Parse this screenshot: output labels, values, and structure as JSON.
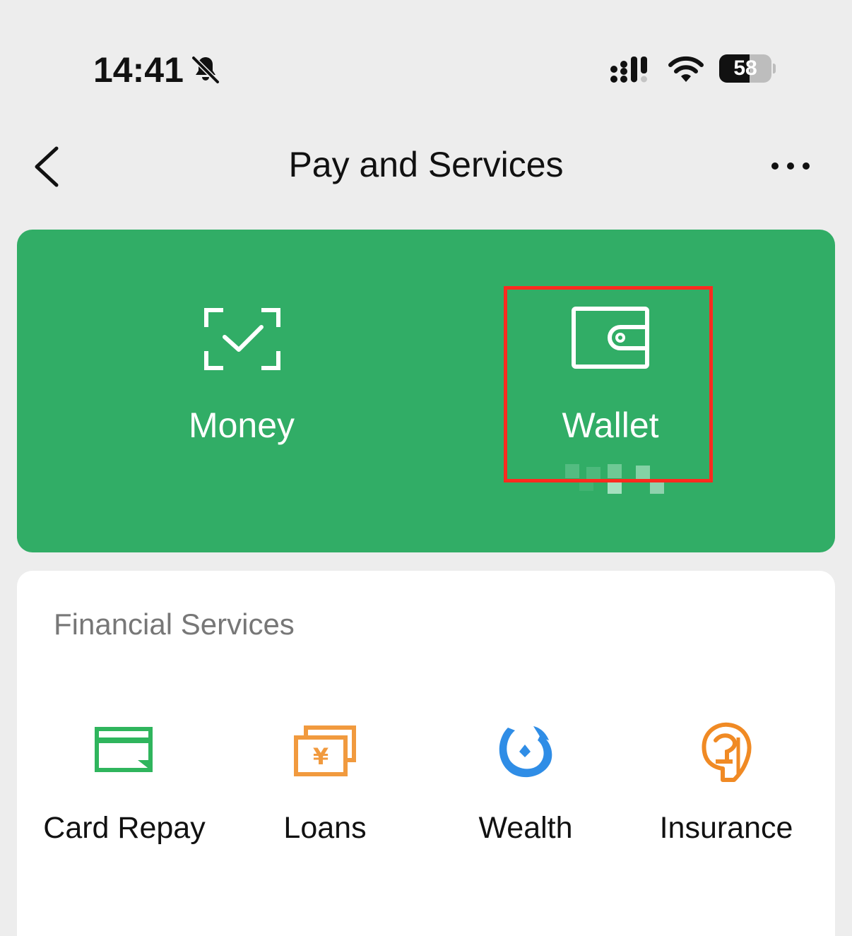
{
  "status_bar": {
    "time": "14:41",
    "battery_level": "58",
    "icons": [
      "bell-slash-icon",
      "cellular-signal-icon",
      "wifi-icon",
      "battery-icon"
    ]
  },
  "nav": {
    "title": "Pay and Services",
    "back_icon": "chevron-left-icon",
    "more_icon": "more-dots-icon"
  },
  "top_actions": [
    {
      "label": "Money",
      "icon": "scan-check-icon"
    },
    {
      "label": "Wallet",
      "icon": "wallet-icon",
      "highlighted": true
    }
  ],
  "financial_services": {
    "title": "Financial Services",
    "items": [
      {
        "label": "Card Repay",
        "icon": "card-repay-icon",
        "color": "#2fb55d"
      },
      {
        "label": "Loans",
        "icon": "loans-yen-icon",
        "color": "#f19a3e"
      },
      {
        "label": "Wealth",
        "icon": "wealth-icon",
        "color": "#2f8de6"
      },
      {
        "label": "Insurance",
        "icon": "insurance-icon",
        "color": "#f08a24"
      }
    ]
  },
  "colors": {
    "background": "#ededed",
    "brand_green": "#31ad66",
    "highlight_red": "#ff2a1f"
  }
}
